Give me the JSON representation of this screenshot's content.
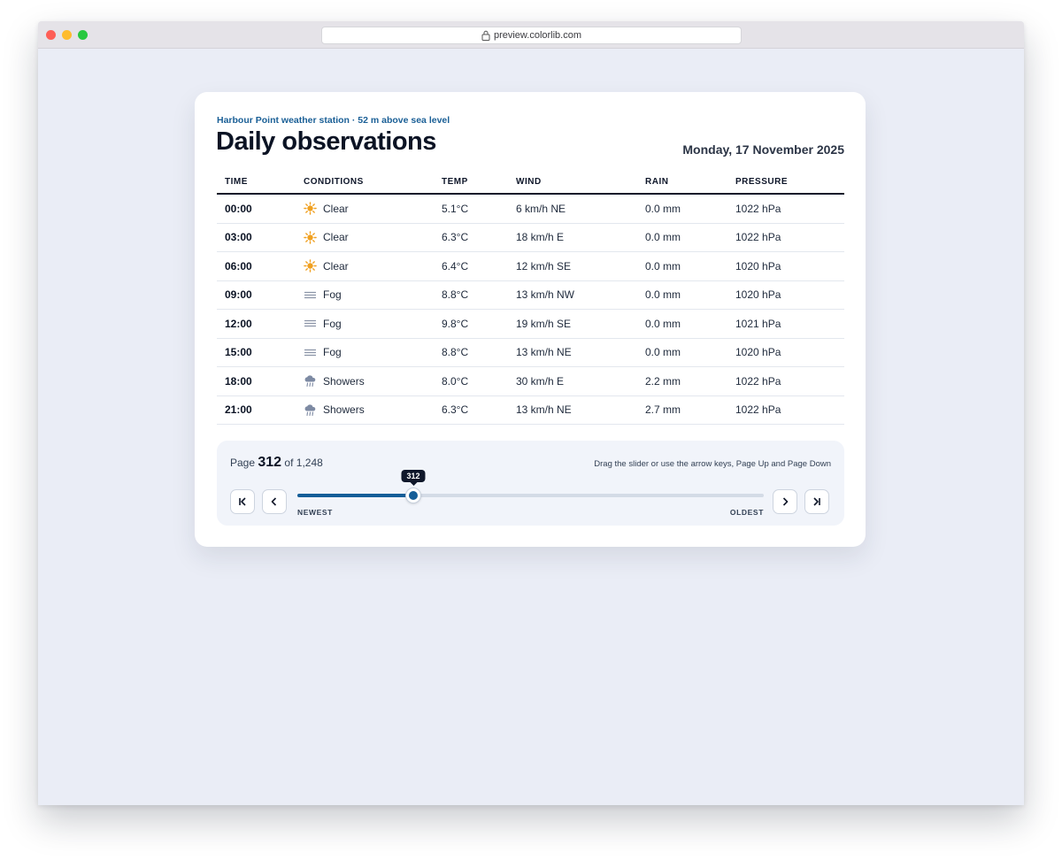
{
  "browser": {
    "url": "preview.colorlib.com"
  },
  "header": {
    "station": "Harbour Point weather station · 52 m above sea level",
    "title": "Daily observations",
    "date": "Monday, 17 November 2025"
  },
  "table": {
    "columns": [
      "TIME",
      "CONDITIONS",
      "TEMP",
      "WIND",
      "RAIN",
      "PRESSURE"
    ],
    "rows": [
      {
        "time": "00:00",
        "icon": "sun-icon",
        "conditions": "Clear",
        "temp": "5.1°C",
        "wind": "6 km/h NE",
        "rain": "0.0 mm",
        "pressure": "1022 hPa"
      },
      {
        "time": "03:00",
        "icon": "sun-icon",
        "conditions": "Clear",
        "temp": "6.3°C",
        "wind": "18 km/h E",
        "rain": "0.0 mm",
        "pressure": "1022 hPa"
      },
      {
        "time": "06:00",
        "icon": "sun-icon",
        "conditions": "Clear",
        "temp": "6.4°C",
        "wind": "12 km/h SE",
        "rain": "0.0 mm",
        "pressure": "1020 hPa"
      },
      {
        "time": "09:00",
        "icon": "fog-icon",
        "conditions": "Fog",
        "temp": "8.8°C",
        "wind": "13 km/h NW",
        "rain": "0.0 mm",
        "pressure": "1020 hPa"
      },
      {
        "time": "12:00",
        "icon": "fog-icon",
        "conditions": "Fog",
        "temp": "9.8°C",
        "wind": "19 km/h SE",
        "rain": "0.0 mm",
        "pressure": "1021 hPa"
      },
      {
        "time": "15:00",
        "icon": "fog-icon",
        "conditions": "Fog",
        "temp": "8.8°C",
        "wind": "13 km/h NE",
        "rain": "0.0 mm",
        "pressure": "1020 hPa"
      },
      {
        "time": "18:00",
        "icon": "showers-icon",
        "conditions": "Showers",
        "temp": "8.0°C",
        "wind": "30 km/h E",
        "rain": "2.2 mm",
        "pressure": "1022 hPa"
      },
      {
        "time": "21:00",
        "icon": "showers-icon",
        "conditions": "Showers",
        "temp": "6.3°C",
        "wind": "13 km/h NE",
        "rain": "2.7 mm",
        "pressure": "1022 hPa"
      }
    ]
  },
  "pager": {
    "page_prefix": "Page",
    "current_page": "312",
    "page_suffix": "of 1,248",
    "hint": "Drag the slider or use the arrow keys, Page Up and Page Down",
    "tooltip": "312",
    "left_label": "NEWEST",
    "right_label": "OLDEST",
    "slider_fraction": 0.2494
  },
  "colors": {
    "accent": "#155e98",
    "sun": "#f0a020",
    "fog": "#8a93a6",
    "showers": "#7d8aa3"
  }
}
